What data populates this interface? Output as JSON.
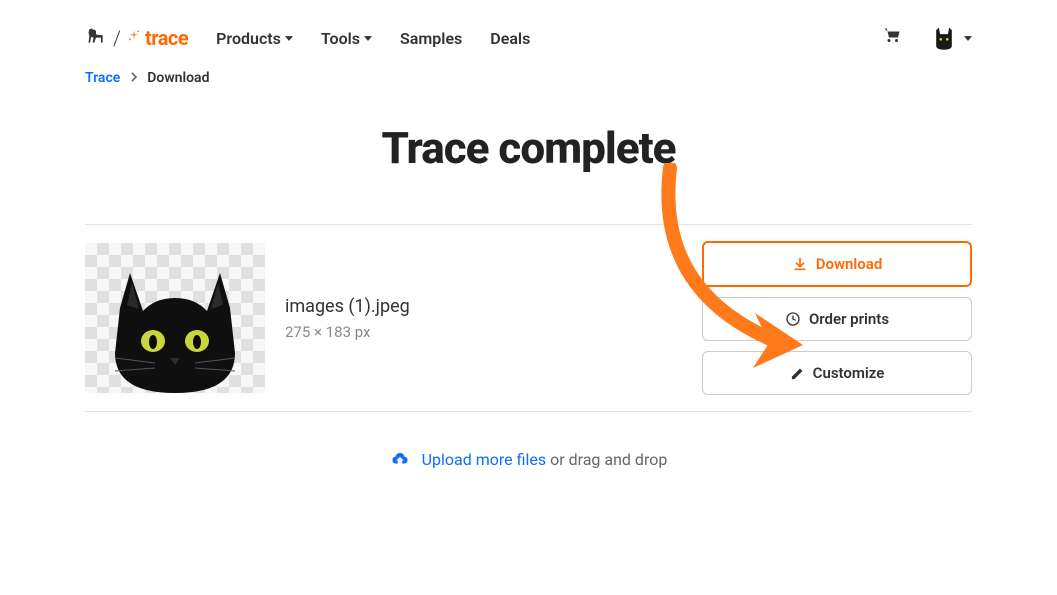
{
  "brand": {
    "text": "trace"
  },
  "nav": {
    "products": "Products",
    "tools": "Tools",
    "samples": "Samples",
    "deals": "Deals"
  },
  "breadcrumb": {
    "root": "Trace",
    "current": "Download"
  },
  "title": "Trace complete",
  "result": {
    "filename": "images (1).jpeg",
    "dimensions": "275 × 183 px"
  },
  "actions": {
    "download": "Download",
    "order_prints": "Order prints",
    "customize": "Customize"
  },
  "upload": {
    "link_text": "Upload more files",
    "rest_text": " or drag and drop"
  },
  "colors": {
    "accent": "#ff6b00",
    "link": "#0d6efd"
  }
}
